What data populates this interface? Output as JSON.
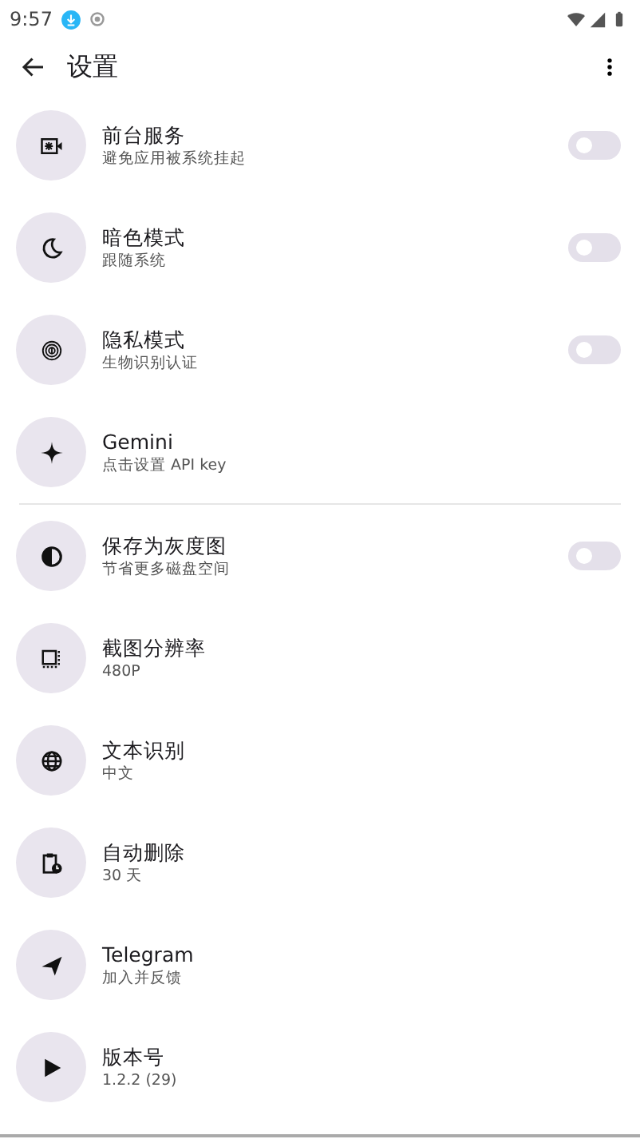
{
  "status_bar": {
    "time": "9:57"
  },
  "app_bar": {
    "title": "设置"
  },
  "sections": [
    {
      "items": [
        {
          "kind": "toggle",
          "title": "前台服务",
          "subtitle": "避免应用被系统挂起",
          "on": false
        },
        {
          "kind": "toggle",
          "title": "暗色模式",
          "subtitle": "跟随系统",
          "on": false
        },
        {
          "kind": "toggle",
          "title": "隐私模式",
          "subtitle": "生物识别认证",
          "on": false
        },
        {
          "kind": "plain",
          "title": "Gemini",
          "subtitle": "点击设置 API key"
        }
      ]
    },
    {
      "items": [
        {
          "kind": "toggle",
          "title": "保存为灰度图",
          "subtitle": "节省更多磁盘空间",
          "on": false
        },
        {
          "kind": "plain",
          "title": "截图分辨率",
          "subtitle": "480P"
        },
        {
          "kind": "plain",
          "title": "文本识别",
          "subtitle": "中文"
        },
        {
          "kind": "plain",
          "title": "自动删除",
          "subtitle": "30 天"
        },
        {
          "kind": "plain",
          "title": "Telegram",
          "subtitle": "加入并反馈"
        },
        {
          "kind": "plain",
          "title": "版本号",
          "subtitle": "1.2.2 (29)"
        }
      ]
    }
  ]
}
